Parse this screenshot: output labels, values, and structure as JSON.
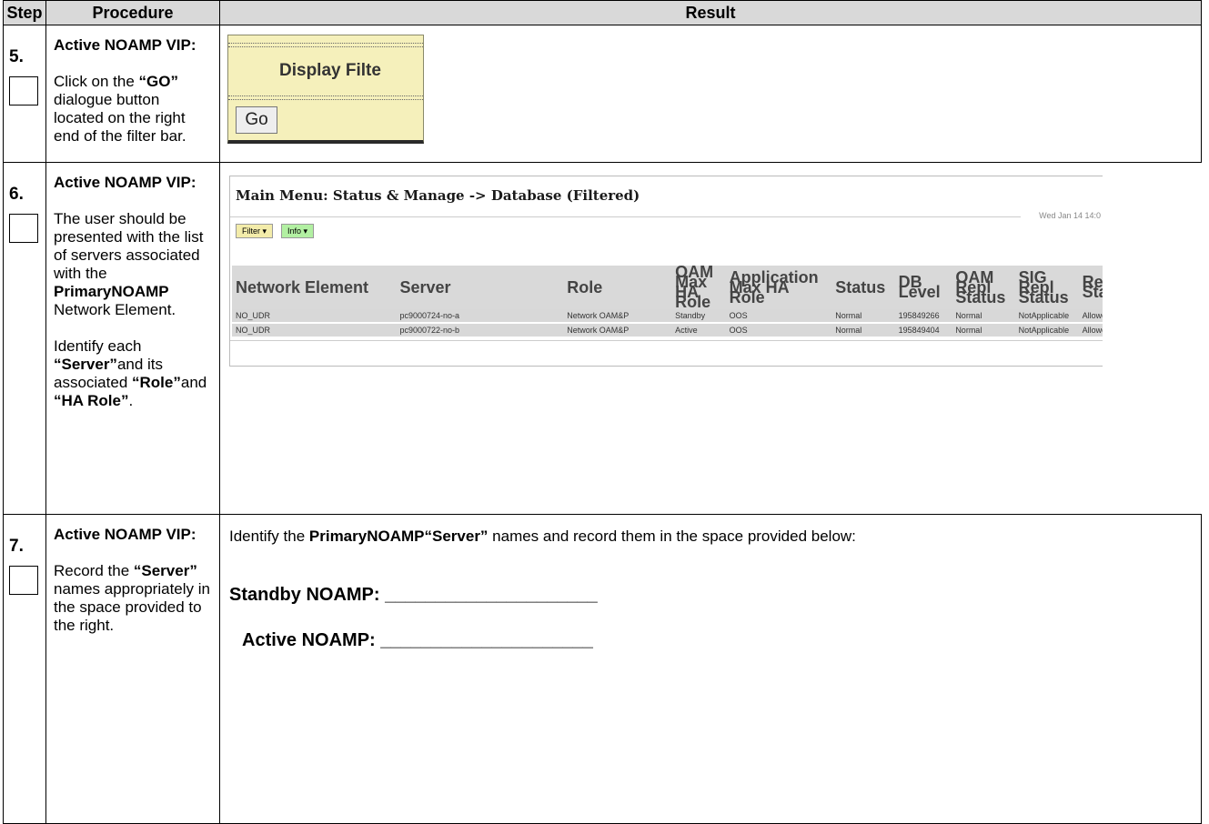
{
  "header": {
    "step": "Step",
    "procedure": "Procedure",
    "result": "Result"
  },
  "step5": {
    "number": "5.",
    "title": "Active NOAMP VIP:",
    "text_before": "Click on the ",
    "go_quoted": "“GO”",
    "text_after": " dialogue button located on the right end of the filter bar.",
    "screenshot": {
      "label": "Display Filte",
      "button": "Go"
    }
  },
  "step6": {
    "number": "6.",
    "title": "Active NOAMP VIP:",
    "text1": "The user should be presented with the list of servers associated with the",
    "element": "PrimaryNOAMP",
    "text2": "Network Element.",
    "text3": "Identify each",
    "q_server": "“Server”",
    "text4": "and its associated",
    "q_role": "“Role”",
    "text5": "and",
    "q_harole": "“HA Role”",
    "text6": ".",
    "screenshot": {
      "title": "Main Menu: Status & Manage -> Database (Filtered)",
      "timestamp": "Wed Jan 14 14:0",
      "filter_tab": "Filter ▾",
      "info_tab": "Info ▾",
      "columns": [
        "Network Element",
        "Server",
        "Role",
        "OAM Max HA Role",
        "Application Max HA Role",
        "Status",
        "DB Level",
        "OAM Repl Status",
        "SIG Repl Status",
        "Repl Status"
      ],
      "rows": [
        [
          "NO_UDR",
          "pc9000724-no-a",
          "Network OAM&P",
          "Standby",
          "OOS",
          "Normal",
          "195849266",
          "Normal",
          "NotApplicable",
          "Allowed"
        ],
        [
          "NO_UDR",
          "pc9000722-no-b",
          "Network OAM&P",
          "Active",
          "OOS",
          "Normal",
          "195849404",
          "Normal",
          "NotApplicable",
          "Allowed"
        ]
      ]
    }
  },
  "step7": {
    "number": "7.",
    "title": "Active NOAMP VIP:",
    "proc_before": "Record the ",
    "proc_server": "“Server”",
    "proc_after": " names appropriately in the space provided to the right.",
    "res_before": "Identify the ",
    "res_element": "PrimaryNOAMP",
    "res_server": "“Server”",
    "res_after": " names and record them in the space provided below:",
    "standby": "Standby NOAMP: _____________________",
    "active": "Active NOAMP: _____________________"
  }
}
